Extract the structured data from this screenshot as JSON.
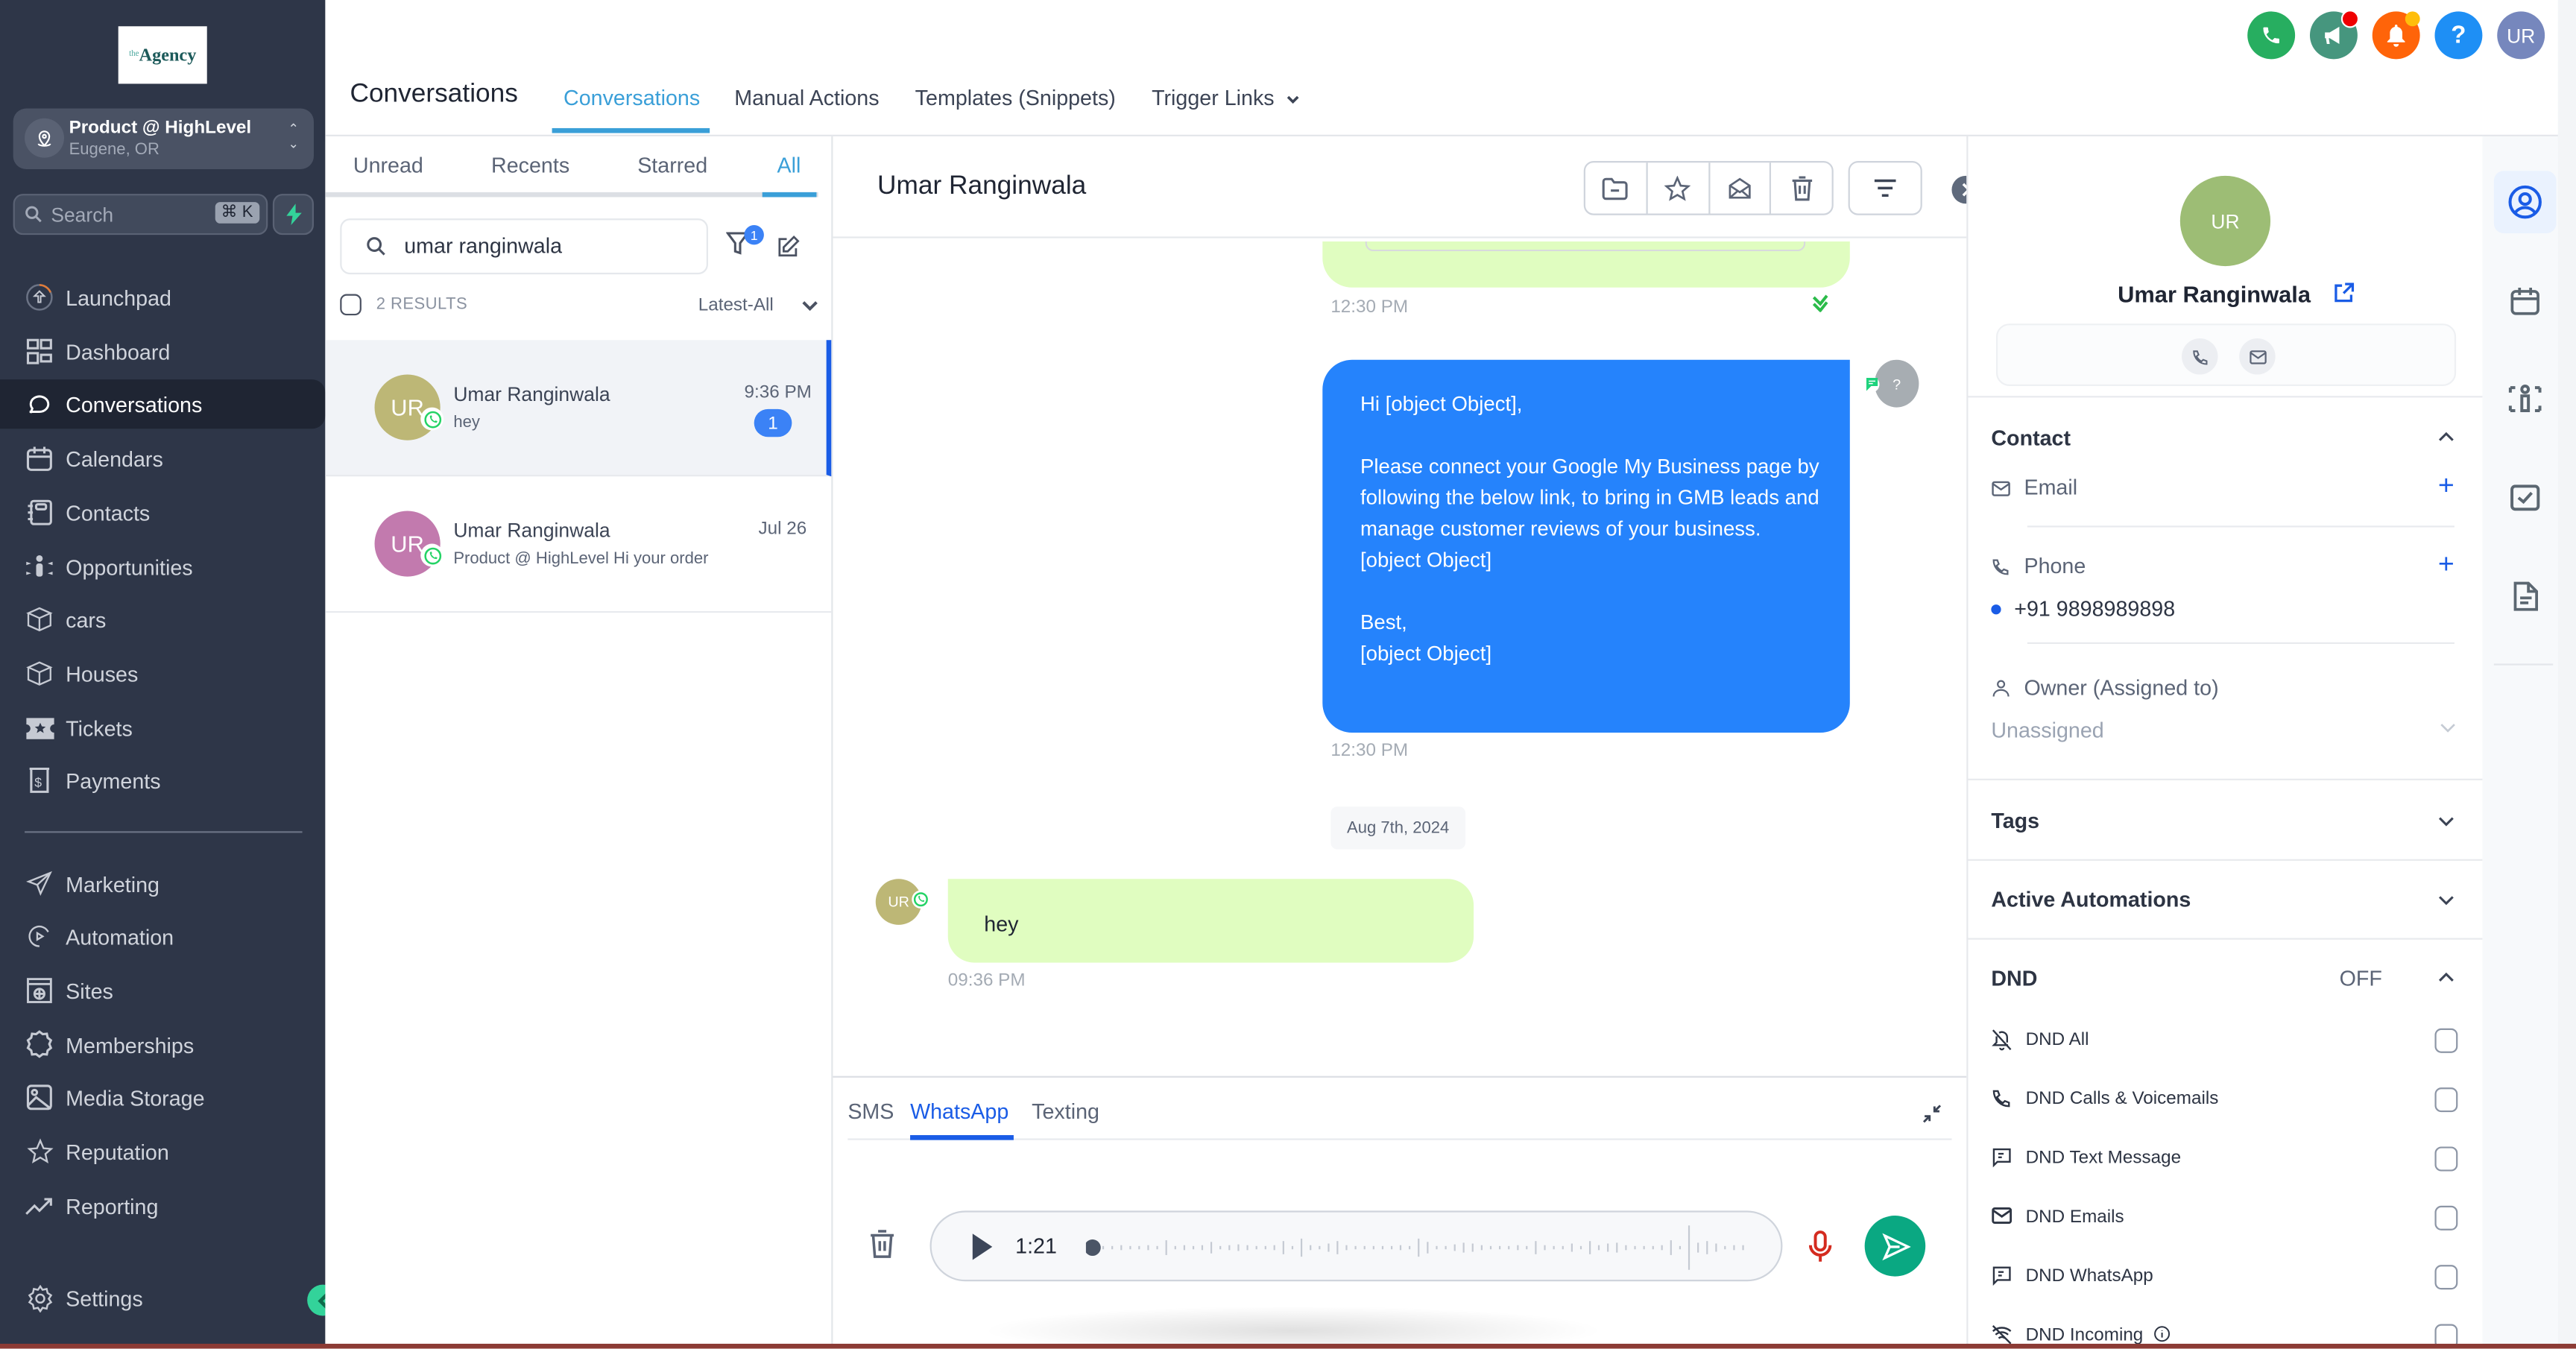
{
  "sidebar": {
    "logo": {
      "prefix": "the",
      "text": "Agency"
    },
    "location": {
      "name": "Product @ HighLevel",
      "city": "Eugene, OR"
    },
    "search": {
      "placeholder": "Search",
      "shortcut": "⌘ K"
    },
    "nav_primary": [
      {
        "label": "Launchpad",
        "icon": "launchpad-icon"
      },
      {
        "label": "Dashboard",
        "icon": "dashboard-icon"
      },
      {
        "label": "Conversations",
        "icon": "chat-bubble-icon",
        "active": true
      },
      {
        "label": "Calendars",
        "icon": "calendar-icon"
      },
      {
        "label": "Contacts",
        "icon": "contacts-book-icon"
      },
      {
        "label": "Opportunities",
        "icon": "opportunities-icon"
      },
      {
        "label": "cars",
        "icon": "box-icon"
      },
      {
        "label": "Houses",
        "icon": "box-icon"
      },
      {
        "label": "Tickets",
        "icon": "ticket-icon"
      },
      {
        "label": "Payments",
        "icon": "payments-icon"
      }
    ],
    "nav_secondary": [
      {
        "label": "Marketing",
        "icon": "send-icon"
      },
      {
        "label": "Automation",
        "icon": "automation-icon"
      },
      {
        "label": "Sites",
        "icon": "sites-icon"
      },
      {
        "label": "Memberships",
        "icon": "badge-icon"
      },
      {
        "label": "Media Storage",
        "icon": "image-icon"
      },
      {
        "label": "Reputation",
        "icon": "star-icon"
      },
      {
        "label": "Reporting",
        "icon": "trend-icon"
      }
    ],
    "settings_label": "Settings"
  },
  "header": {
    "title": "Conversations",
    "tabs": [
      {
        "label": "Conversations",
        "active": true
      },
      {
        "label": "Manual Actions"
      },
      {
        "label": "Templates (Snippets)"
      },
      {
        "label": "Trigger Links",
        "dropdown": true
      }
    ],
    "actions": [
      {
        "name": "phone",
        "color": "#27ae60"
      },
      {
        "name": "announcements",
        "color": "#46967e",
        "dot_color": "#ef0000"
      },
      {
        "name": "notifications",
        "color": "#ff6409",
        "dot_color": "#ffbe0b"
      },
      {
        "name": "help",
        "color": "#1e8ff5",
        "label": "?"
      },
      {
        "name": "profile",
        "color": "#7687bd",
        "label": "UR"
      }
    ]
  },
  "conversation_list": {
    "filter_tabs": [
      {
        "label": "Unread"
      },
      {
        "label": "Recents"
      },
      {
        "label": "Starred"
      },
      {
        "label": "All",
        "active": true
      }
    ],
    "search_value": "umar ranginwala",
    "filter_count": "1",
    "results_label": "2 RESULTS",
    "sort_label": "Latest-All",
    "items": [
      {
        "initials": "UR",
        "avatar_color": "#bdb776",
        "name": "Umar Ranginwala",
        "preview": "hey",
        "time": "9:36 PM",
        "unread": "1",
        "channel": "whatsapp",
        "active": true
      },
      {
        "initials": "UR",
        "avatar_color": "#c27aae",
        "name": "Umar Ranginwala",
        "preview": "Product @ HighLevel Hi your order",
        "time": "Jul 26",
        "channel": "whatsapp"
      }
    ]
  },
  "chat": {
    "contact_name": "Umar Ranginwala",
    "toolbar": [
      "move-to-folder",
      "star",
      "mark-unread",
      "delete",
      "sort"
    ],
    "messages": [
      {
        "direction": "outbound",
        "partial": true,
        "time": "12:30 PM",
        "status": "read"
      },
      {
        "direction": "outbound",
        "text": "Hi [object Object],\n\nPlease connect your Google My Business page by following the below link, to bring in GMB leads and manage customer reviews of your business.\n[object Object]\n\nBest,\n[object Object]",
        "time": "12:30 PM",
        "sender_initials": "?"
      },
      {
        "direction": "inbound",
        "text": "hey",
        "time": "09:36 PM",
        "sender_initials": "UR"
      }
    ],
    "date_separator": "Aug 7th, 2024",
    "composer": {
      "channels": [
        {
          "label": "SMS"
        },
        {
          "label": "WhatsApp",
          "active": true
        },
        {
          "label": "Texting"
        }
      ],
      "audio_duration": "1:21",
      "audio_progress": 0
    }
  },
  "contact_panel": {
    "initials": "UR",
    "avatar_color": "#9dbd75",
    "name": "Umar Ranginwala",
    "sections": {
      "contact": {
        "title": "Contact",
        "email_label": "Email",
        "phone_label": "Phone",
        "phone_value": "+91 9898989898",
        "owner_label": "Owner (Assigned to)",
        "owner_value": "Unassigned"
      },
      "tags": {
        "title": "Tags"
      },
      "automations": {
        "title": "Active Automations"
      },
      "dnd": {
        "title": "DND",
        "status": "OFF",
        "items": [
          {
            "label": "DND All",
            "icon": "bell-off-icon",
            "checked": false
          },
          {
            "label": "DND Calls & Voicemails",
            "icon": "phone-icon",
            "checked": false
          },
          {
            "label": "DND Text Message",
            "icon": "message-icon",
            "checked": false
          },
          {
            "label": "DND Emails",
            "icon": "mail-icon",
            "checked": false
          },
          {
            "label": "DND WhatsApp",
            "icon": "message-icon",
            "checked": false
          },
          {
            "label": "DND Incoming",
            "icon": "signal-off-icon",
            "checked": false,
            "info": true
          }
        ]
      }
    }
  },
  "right_rail": [
    "contact-details",
    "appointments",
    "opportunities",
    "tasks",
    "notes"
  ]
}
